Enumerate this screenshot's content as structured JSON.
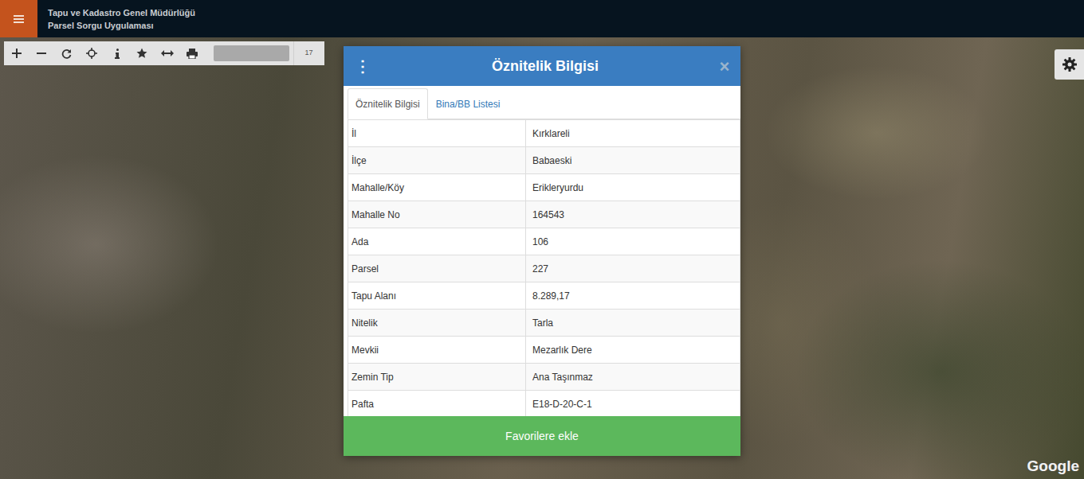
{
  "header": {
    "title": "Tapu ve Kadastro Genel Müdürlüğü",
    "subtitle": "Parsel Sorgu Uygulaması"
  },
  "toolbar": {
    "zoom": "17"
  },
  "dialog": {
    "menu": "⋮",
    "title": "Öznitelik Bilgisi",
    "close": "×",
    "tabs": [
      {
        "label": "Öznitelik Bilgisi",
        "selected": true
      },
      {
        "label": "Bina/BB Listesi",
        "selected": false
      }
    ],
    "rows": [
      {
        "label": "İl",
        "value": "Kırklareli"
      },
      {
        "label": "İlçe",
        "value": "Babaeski"
      },
      {
        "label": "Mahalle/Köy",
        "value": "Erikleryurdu"
      },
      {
        "label": "Mahalle No",
        "value": "164543"
      },
      {
        "label": "Ada",
        "value": "106"
      },
      {
        "label": "Parsel",
        "value": "227"
      },
      {
        "label": "Tapu Alanı",
        "value": "8.289,17"
      },
      {
        "label": "Nitelik",
        "value": "Tarla"
      },
      {
        "label": "Mevkii",
        "value": "Mezarlık Dere"
      },
      {
        "label": "Zemin Tip",
        "value": "Ana Taşınmaz"
      },
      {
        "label": "Pafta",
        "value": "E18-D-20-C-1"
      }
    ],
    "button": "Favorilere ekle"
  },
  "map": {
    "attribution": "Google"
  }
}
